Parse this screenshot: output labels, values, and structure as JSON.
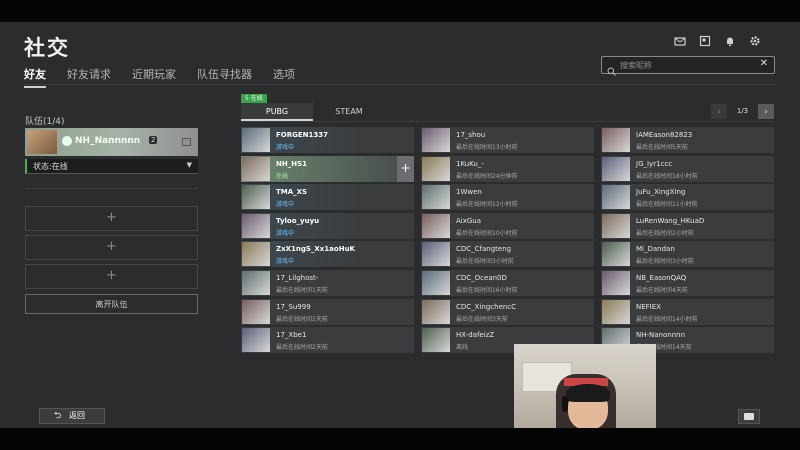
{
  "page": {
    "title": "社交"
  },
  "tabs": [
    {
      "label": "好友",
      "active": true
    },
    {
      "label": "好友请求",
      "active": false
    },
    {
      "label": "近期玩家",
      "active": false
    },
    {
      "label": "队伍寻找器",
      "active": false
    },
    {
      "label": "选项",
      "active": false
    }
  ],
  "header_icons": [
    "mail-icon",
    "profile-card-icon",
    "bell-icon",
    "gear-icon"
  ],
  "search": {
    "placeholder": "搜索昵称",
    "clear": "✕"
  },
  "team": {
    "label": "队伍(1/4)",
    "member": {
      "name": "NH_Nannnnn",
      "badge": "2"
    },
    "status_select": "状态:在线",
    "empty_slot_symbol": "+",
    "leave_button": "离开队伍"
  },
  "friends_panel": {
    "online_badge": "5 在线",
    "platform_tabs": [
      {
        "label": "PUBG",
        "active": true
      },
      {
        "label": "STEAM",
        "active": false
      }
    ],
    "pager": {
      "page": "1/3",
      "prev": "‹",
      "next": "›"
    },
    "add_symbol": "+",
    "columns": [
      [
        {
          "name": "FORGEN1337",
          "status": "游戏中",
          "state": "online"
        },
        {
          "name": "NH_HS1",
          "status": "在线",
          "state": "selected"
        },
        {
          "name": "TMA_XS",
          "status": "游戏中",
          "state": "online"
        },
        {
          "name": "Tyloo_yuyu",
          "status": "游戏中",
          "state": "online"
        },
        {
          "name": "ZxX1ngS_Xx1aoHuK",
          "status": "游戏中",
          "state": "online"
        },
        {
          "name": "17_Lilghost-",
          "status": "最后在线时间1天前",
          "state": "offline"
        },
        {
          "name": "17_Su999",
          "status": "最后在线时间2天前",
          "state": "offline"
        },
        {
          "name": "17_Xbe1",
          "status": "最后在线时间2天前",
          "state": "offline"
        }
      ],
      [
        {
          "name": "17_shou",
          "status": "最后在线时间13小时前",
          "state": "offline"
        },
        {
          "name": "1KuKu_-",
          "status": "最后在线时间24分钟前",
          "state": "offline"
        },
        {
          "name": "1Wwen",
          "status": "最后在线时间12小时前",
          "state": "offline"
        },
        {
          "name": "AixGua",
          "status": "最后在线时间10小时前",
          "state": "offline"
        },
        {
          "name": "CDC_Cfangteng",
          "status": "最后在线时间3小时前",
          "state": "offline"
        },
        {
          "name": "CDC_Ocean0D",
          "status": "最后在线时间16小时前",
          "state": "offline"
        },
        {
          "name": "CDC_XingchencC",
          "status": "最后在线时间3天前",
          "state": "offline"
        },
        {
          "name": "HX-dafeizZ",
          "status": "离线",
          "state": "offline"
        }
      ],
      [
        {
          "name": "IAMEason82823",
          "status": "最后在线时间5天前",
          "state": "offline"
        },
        {
          "name": "JG_Iyr1ccc",
          "status": "最后在线时间18小时前",
          "state": "offline"
        },
        {
          "name": "JuFu_XingXing",
          "status": "最后在线时间11小时前",
          "state": "offline"
        },
        {
          "name": "LuRenWang_HKuaD",
          "status": "最后在线时间2小时前",
          "state": "offline"
        },
        {
          "name": "Mi_Dandan",
          "status": "最后在线时间3小时前",
          "state": "offline"
        },
        {
          "name": "NB_EasonQAQ",
          "status": "最后在线时间4天前",
          "state": "offline"
        },
        {
          "name": "NEFIEX",
          "status": "最后在线时间14小时前",
          "state": "offline"
        },
        {
          "name": "NH-Nanonnnn",
          "status": "最后在线时间14天前",
          "state": "offline"
        }
      ]
    ]
  },
  "footer": {
    "back_label": "返回",
    "back_arrow": "⮌"
  },
  "colors": {
    "background": "#2b2c2e",
    "online_green": "#3aa24a",
    "playing_blue": "#6fc2ff"
  }
}
